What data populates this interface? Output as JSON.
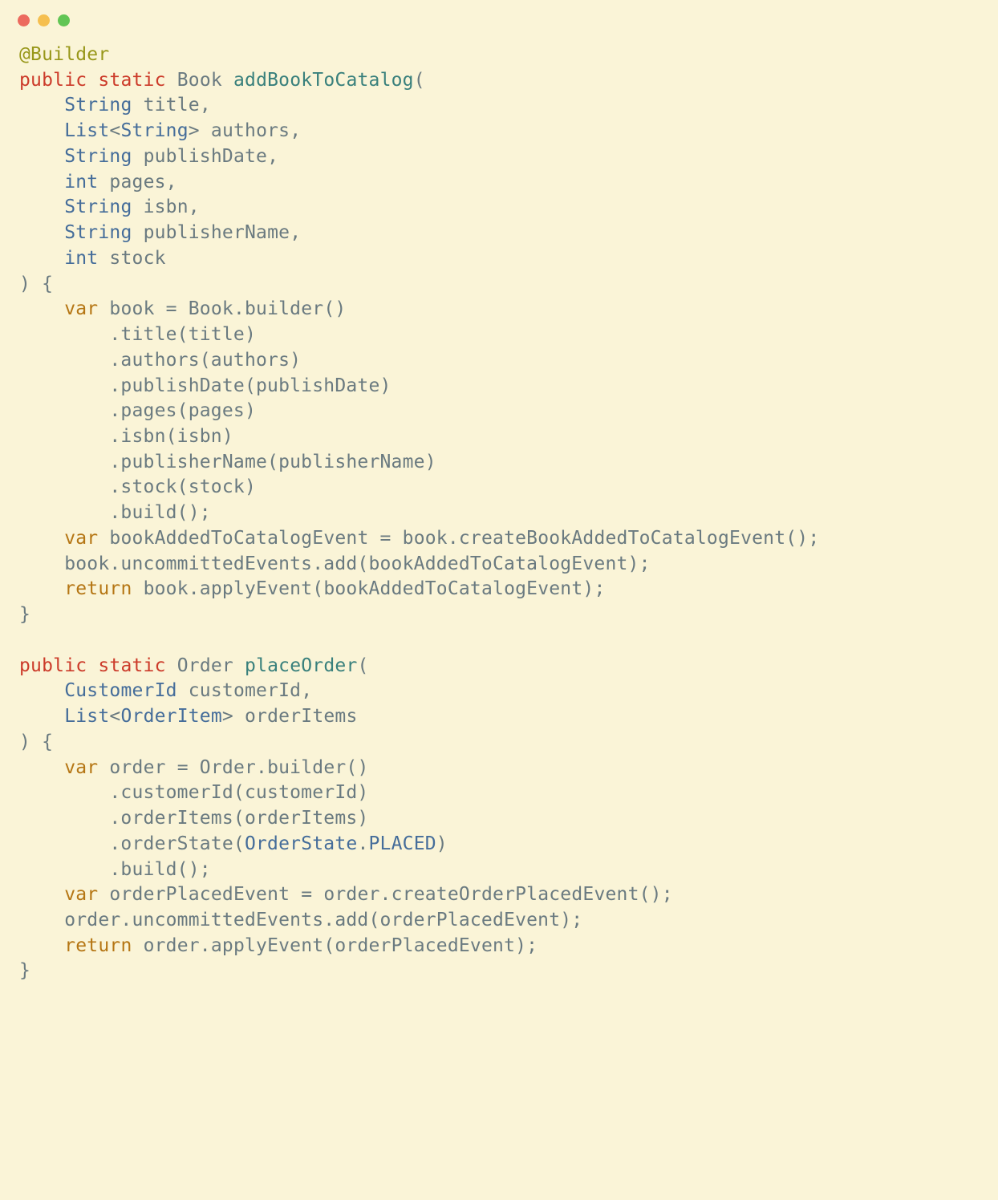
{
  "code": {
    "lines": [
      [
        {
          "cls": "annot",
          "t": "@Builder"
        }
      ],
      [
        {
          "cls": "kw-mod",
          "t": "public"
        },
        {
          "cls": "punct",
          "t": " "
        },
        {
          "cls": "kw-mod",
          "t": "static"
        },
        {
          "cls": "punct",
          "t": " "
        },
        {
          "cls": "ident",
          "t": "Book "
        },
        {
          "cls": "method",
          "t": "addBookToCatalog"
        },
        {
          "cls": "punct",
          "t": "("
        }
      ],
      [
        {
          "cls": "punct",
          "t": "    "
        },
        {
          "cls": "type",
          "t": "String"
        },
        {
          "cls": "punct",
          "t": " "
        },
        {
          "cls": "ident",
          "t": "title"
        },
        {
          "cls": "punct",
          "t": ","
        }
      ],
      [
        {
          "cls": "punct",
          "t": "    "
        },
        {
          "cls": "type",
          "t": "List"
        },
        {
          "cls": "generic",
          "t": "<"
        },
        {
          "cls": "type",
          "t": "String"
        },
        {
          "cls": "generic",
          "t": ">"
        },
        {
          "cls": "punct",
          "t": " "
        },
        {
          "cls": "ident",
          "t": "authors"
        },
        {
          "cls": "punct",
          "t": ","
        }
      ],
      [
        {
          "cls": "punct",
          "t": "    "
        },
        {
          "cls": "type",
          "t": "String"
        },
        {
          "cls": "punct",
          "t": " "
        },
        {
          "cls": "ident",
          "t": "publishDate"
        },
        {
          "cls": "punct",
          "t": ","
        }
      ],
      [
        {
          "cls": "punct",
          "t": "    "
        },
        {
          "cls": "type",
          "t": "int"
        },
        {
          "cls": "punct",
          "t": " "
        },
        {
          "cls": "ident",
          "t": "pages"
        },
        {
          "cls": "punct",
          "t": ","
        }
      ],
      [
        {
          "cls": "punct",
          "t": "    "
        },
        {
          "cls": "type",
          "t": "String"
        },
        {
          "cls": "punct",
          "t": " "
        },
        {
          "cls": "ident",
          "t": "isbn"
        },
        {
          "cls": "punct",
          "t": ","
        }
      ],
      [
        {
          "cls": "punct",
          "t": "    "
        },
        {
          "cls": "type",
          "t": "String"
        },
        {
          "cls": "punct",
          "t": " "
        },
        {
          "cls": "ident",
          "t": "publisherName"
        },
        {
          "cls": "punct",
          "t": ","
        }
      ],
      [
        {
          "cls": "punct",
          "t": "    "
        },
        {
          "cls": "type",
          "t": "int"
        },
        {
          "cls": "punct",
          "t": " "
        },
        {
          "cls": "ident",
          "t": "stock"
        }
      ],
      [
        {
          "cls": "punct",
          "t": ") {"
        }
      ],
      [
        {
          "cls": "punct",
          "t": "    "
        },
        {
          "cls": "kw-var",
          "t": "var"
        },
        {
          "cls": "punct",
          "t": " "
        },
        {
          "cls": "ident",
          "t": "book = Book.builder()"
        }
      ],
      [
        {
          "cls": "ident",
          "t": "        .title(title)"
        }
      ],
      [
        {
          "cls": "ident",
          "t": "        .authors(authors)"
        }
      ],
      [
        {
          "cls": "ident",
          "t": "        .publishDate(publishDate)"
        }
      ],
      [
        {
          "cls": "ident",
          "t": "        .pages(pages)"
        }
      ],
      [
        {
          "cls": "ident",
          "t": "        .isbn(isbn)"
        }
      ],
      [
        {
          "cls": "ident",
          "t": "        .publisherName(publisherName)"
        }
      ],
      [
        {
          "cls": "ident",
          "t": "        .stock(stock)"
        }
      ],
      [
        {
          "cls": "ident",
          "t": "        .build();"
        }
      ],
      [
        {
          "cls": "punct",
          "t": "    "
        },
        {
          "cls": "kw-var",
          "t": "var"
        },
        {
          "cls": "punct",
          "t": " "
        },
        {
          "cls": "ident",
          "t": "bookAddedToCatalogEvent = book.createBookAddedToCatalogEvent();"
        }
      ],
      [
        {
          "cls": "ident",
          "t": "    book.uncommittedEvents.add(bookAddedToCatalogEvent);"
        }
      ],
      [
        {
          "cls": "punct",
          "t": "    "
        },
        {
          "cls": "kw-var",
          "t": "return"
        },
        {
          "cls": "punct",
          "t": " "
        },
        {
          "cls": "ident",
          "t": "book.applyEvent(bookAddedToCatalogEvent);"
        }
      ],
      [
        {
          "cls": "punct",
          "t": "}"
        }
      ],
      [
        {
          "cls": "punct",
          "t": ""
        }
      ],
      [
        {
          "cls": "kw-mod",
          "t": "public"
        },
        {
          "cls": "punct",
          "t": " "
        },
        {
          "cls": "kw-mod",
          "t": "static"
        },
        {
          "cls": "punct",
          "t": " "
        },
        {
          "cls": "ident",
          "t": "Order "
        },
        {
          "cls": "method",
          "t": "placeOrder"
        },
        {
          "cls": "punct",
          "t": "("
        }
      ],
      [
        {
          "cls": "punct",
          "t": "    "
        },
        {
          "cls": "type",
          "t": "CustomerId"
        },
        {
          "cls": "punct",
          "t": " "
        },
        {
          "cls": "ident",
          "t": "customerId"
        },
        {
          "cls": "punct",
          "t": ","
        }
      ],
      [
        {
          "cls": "punct",
          "t": "    "
        },
        {
          "cls": "type",
          "t": "List"
        },
        {
          "cls": "generic",
          "t": "<"
        },
        {
          "cls": "type",
          "t": "OrderItem"
        },
        {
          "cls": "generic",
          "t": ">"
        },
        {
          "cls": "punct",
          "t": " "
        },
        {
          "cls": "ident",
          "t": "orderItems"
        }
      ],
      [
        {
          "cls": "punct",
          "t": ") {"
        }
      ],
      [
        {
          "cls": "punct",
          "t": "    "
        },
        {
          "cls": "kw-var",
          "t": "var"
        },
        {
          "cls": "punct",
          "t": " "
        },
        {
          "cls": "ident",
          "t": "order = Order.builder()"
        }
      ],
      [
        {
          "cls": "ident",
          "t": "        .customerId(customerId)"
        }
      ],
      [
        {
          "cls": "ident",
          "t": "        .orderItems(orderItems)"
        }
      ],
      [
        {
          "cls": "punct",
          "t": "        .orderState("
        },
        {
          "cls": "enum",
          "t": "OrderState"
        },
        {
          "cls": "punct",
          "t": "."
        },
        {
          "cls": "enum",
          "t": "PLACED"
        },
        {
          "cls": "punct",
          "t": ")"
        }
      ],
      [
        {
          "cls": "ident",
          "t": "        .build();"
        }
      ],
      [
        {
          "cls": "punct",
          "t": "    "
        },
        {
          "cls": "kw-var",
          "t": "var"
        },
        {
          "cls": "punct",
          "t": " "
        },
        {
          "cls": "ident",
          "t": "orderPlacedEvent = order.createOrderPlacedEvent();"
        }
      ],
      [
        {
          "cls": "ident",
          "t": "    order.uncommittedEvents.add(orderPlacedEvent);"
        }
      ],
      [
        {
          "cls": "punct",
          "t": "    "
        },
        {
          "cls": "kw-var",
          "t": "return"
        },
        {
          "cls": "punct",
          "t": " "
        },
        {
          "cls": "ident",
          "t": "order.applyEvent(orderPlacedEvent);"
        }
      ],
      [
        {
          "cls": "punct",
          "t": "}"
        }
      ]
    ]
  }
}
